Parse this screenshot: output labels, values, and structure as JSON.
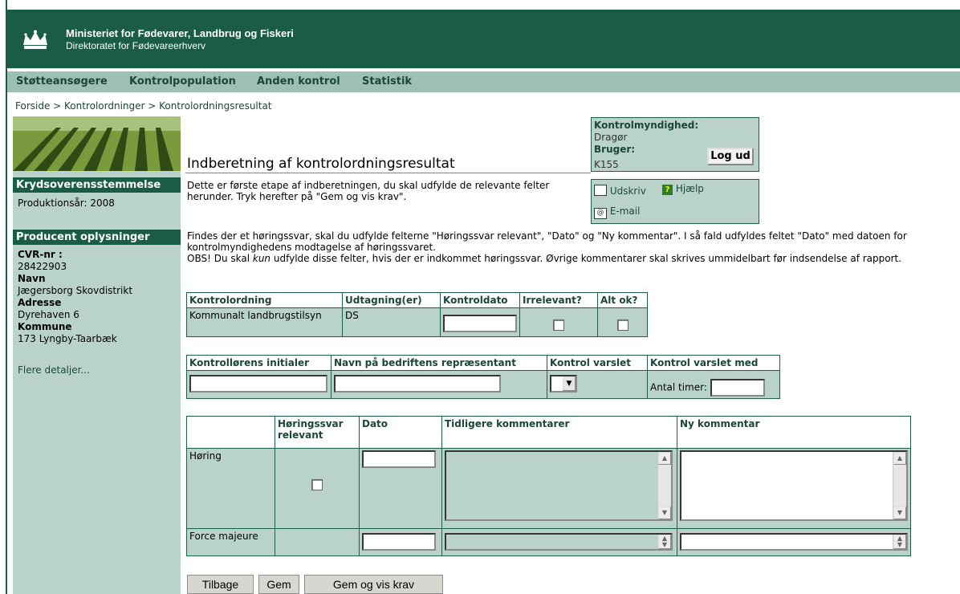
{
  "header": {
    "ministry": "Ministeriet for Fødevarer, Landbrug og Fiskeri",
    "directorate": "Direktoratet for Fødevareerhverv"
  },
  "nav": [
    "Støtteansøgere",
    "Kontrolpopulation",
    "Anden kontrol",
    "Statistik"
  ],
  "breadcrumb": {
    "home": "Forside",
    "sep": " > ",
    "level1": "Kontrolordninger",
    "current": "Kontrolordningsresultat"
  },
  "left": {
    "section1_title": "Krydsoverensstemmelse",
    "production_year": "Produktionsår: 2008",
    "section2_title": "Producent oplysninger",
    "cvr_label": "CVR-nr :",
    "cvr_value": "28422903",
    "name_label": "Navn",
    "name_value": "Jægersborg Skovdistrikt",
    "address_label": "Adresse",
    "address_value": "Dyrehaven 6",
    "municipality_label": "Kommune",
    "municipality_value": "173 Lyngby-Taarbæk",
    "more_link": "Flere detaljer..."
  },
  "page": {
    "title": "Indberetning af kontrolordningsresultat",
    "intro": "Dette er første etape af indberetningen, du skal udfylde de relevante felter herunder. Tryk herefter på \"Gem og vis krav\".",
    "para1": "Findes der et høringssvar, skal du udfylde felterne \"Høringssvar relevant\", \"Dato\" og \"Ny kommentar\". I så fald udfyldes feltet \"Dato\" med datoen for kontrolmyndighedens modtagelse af høringssvaret.",
    "para2_pre": "OBS! Du skal ",
    "para2_em": "kun",
    "para2_post": " udfylde disse felter, hvis der er indkommet høringssvar. Øvrige kommentarer skal skrives ummidelbart før indsendelse af rapport."
  },
  "auth": {
    "authority_label": "Kontrolmyndighed:",
    "authority_value": "Dragør",
    "user_label": "Bruger:",
    "user_value": "K155",
    "logout": "Log ud"
  },
  "tools": {
    "print": "Udskriv",
    "help": "Hjælp",
    "email": "E-mail"
  },
  "table1": {
    "headers": [
      "Kontrolordning",
      "Udtagning(er)",
      "Kontroldato",
      "Irrelevant?",
      "Alt ok?"
    ],
    "row": {
      "ordning": "Kommunalt landbrugstilsyn",
      "udtagning": "DS",
      "kontroldato": ""
    }
  },
  "table2": {
    "headers": [
      "Kontrollørens initialer",
      "Navn på bedriftens repræsentant",
      "Kontrol varslet",
      "Kontrol varslet med"
    ],
    "hours_label": "Antal timer:",
    "select_value": ""
  },
  "table3": {
    "headers": [
      "",
      "Høringssvar relevant",
      "Dato",
      "Tidligere kommentarer",
      "Ny kommentar"
    ],
    "rows": [
      {
        "label": "Høring"
      },
      {
        "label": "Force majeure"
      }
    ]
  },
  "buttons": {
    "back": "Tilbage",
    "save": "Gem",
    "save_show": "Gem og vis krav"
  },
  "colors": {
    "header_green": "#1a5c46",
    "nav_green": "#9ebfb4",
    "panel_green": "#b9d3cb"
  }
}
